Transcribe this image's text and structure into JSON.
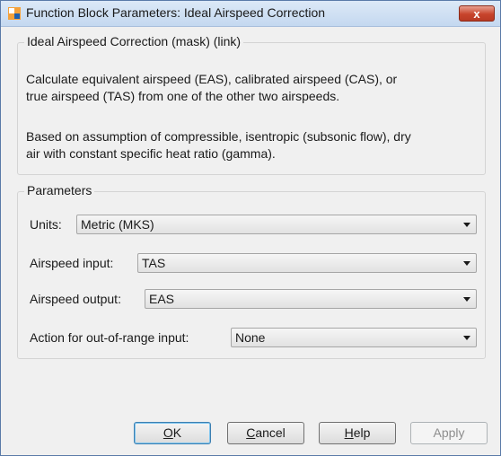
{
  "window": {
    "title": "Function Block Parameters: Ideal Airspeed Correction",
    "close_label": "x"
  },
  "block": {
    "legend": "Ideal Airspeed Correction (mask) (link)",
    "description_1_line1": "Calculate equivalent airspeed (EAS), calibrated airspeed (CAS), or",
    "description_1_line2": "true airspeed (TAS) from one of the other two airspeeds.",
    "description_2_line1": "Based on assumption of compressible, isentropic (subsonic flow), dry",
    "description_2_line2": "air with constant specific heat ratio (gamma)."
  },
  "parameters": {
    "legend": "Parameters",
    "units": {
      "label": "Units:",
      "value": "Metric (MKS)"
    },
    "airspeed_input": {
      "label": "Airspeed input:",
      "value": "TAS"
    },
    "airspeed_output": {
      "label": "Airspeed output:",
      "value": "EAS"
    },
    "out_of_range": {
      "label": "Action for out-of-range input:",
      "value": "None"
    }
  },
  "buttons": {
    "ok": {
      "first": "O",
      "rest": "K"
    },
    "cancel": {
      "first": "C",
      "rest": "ancel"
    },
    "help": {
      "first": "H",
      "rest": "elp"
    },
    "apply": "Apply"
  },
  "colors": {
    "close_button": "#c8442c",
    "titlebar": "#c4d8f0",
    "dialog_bg": "#f0f0f0"
  },
  "icons": [
    "simulink-block-icon",
    "close-icon",
    "chevron-down-icon"
  ]
}
